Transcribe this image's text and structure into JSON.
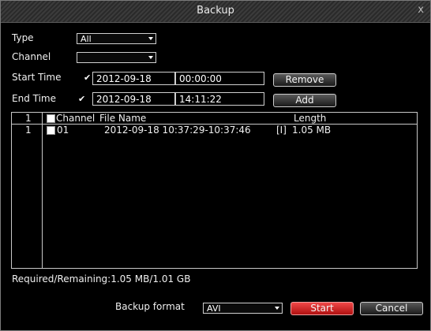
{
  "window": {
    "title": "Backup",
    "close_glyph": "x"
  },
  "form": {
    "type_label": "Type",
    "type_value": "All",
    "channel_label": "Channel",
    "channel_value": "",
    "start_label": "Start Time",
    "start_date": "2012-09-18",
    "start_time": "00:00:00",
    "end_label": "End Time",
    "end_date": "2012-09-18",
    "end_time": "14:11:22",
    "checkbox_glyph": "✔"
  },
  "buttons": {
    "remove": "Remove",
    "add": "Add",
    "start": "Start",
    "cancel": "Cancel"
  },
  "table": {
    "headers": {
      "index": "1",
      "channel": "Channel",
      "file_name": "File Name",
      "length": "Length"
    },
    "rows": [
      {
        "index": "1",
        "channel": "01",
        "file_name": "2012-09-18 10:37:29-10:37:46",
        "flag": "[I]",
        "length": "1.05 MB"
      }
    ]
  },
  "status": {
    "required_remaining": "Required/Remaining:1.05 MB/1.01 GB"
  },
  "footer": {
    "format_label": "Backup format",
    "format_value": "AVI"
  },
  "colors": {
    "start_button": "#d82020",
    "border": "#c8c8c8"
  }
}
